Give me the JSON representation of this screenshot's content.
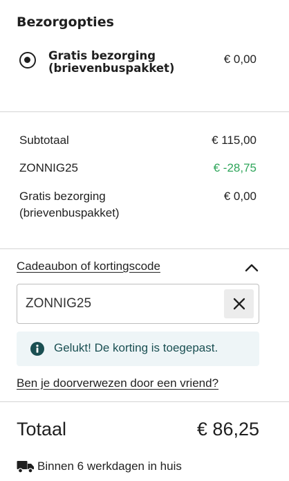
{
  "delivery": {
    "heading": "Bezorgopties",
    "option_label": "Gratis bezorging (brievenbuspakket)",
    "option_price": "€ 0,00",
    "option_selected": true
  },
  "summary": {
    "rows": [
      {
        "label": "Subtotaal",
        "value": "€ 115,00"
      },
      {
        "label": "ZONNIG25",
        "value": "€ -28,75",
        "color": "#2ea55a"
      },
      {
        "label": "Gratis bezorging (brievenbuspakket)",
        "value": "€ 0,00"
      }
    ]
  },
  "coupon": {
    "toggle_label": "Cadeaubon of kortingscode",
    "expanded": true,
    "input_value": "ZONNIG25",
    "clear_icon": "close-icon",
    "notice_icon": "info-icon",
    "notice_text": "Gelukt! De korting is toegepast.",
    "referral_link": "Ben je doorverwezen door een vriend?"
  },
  "total": {
    "label": "Totaal",
    "value": "€ 86,25",
    "delivery_icon": "truck-icon",
    "delivery_text": "Binnen 6 werkdagen in huis"
  },
  "colors": {
    "discount_green": "#2ea55a",
    "notice_bg": "#eef5f7",
    "notice_text": "#1a4f52"
  }
}
